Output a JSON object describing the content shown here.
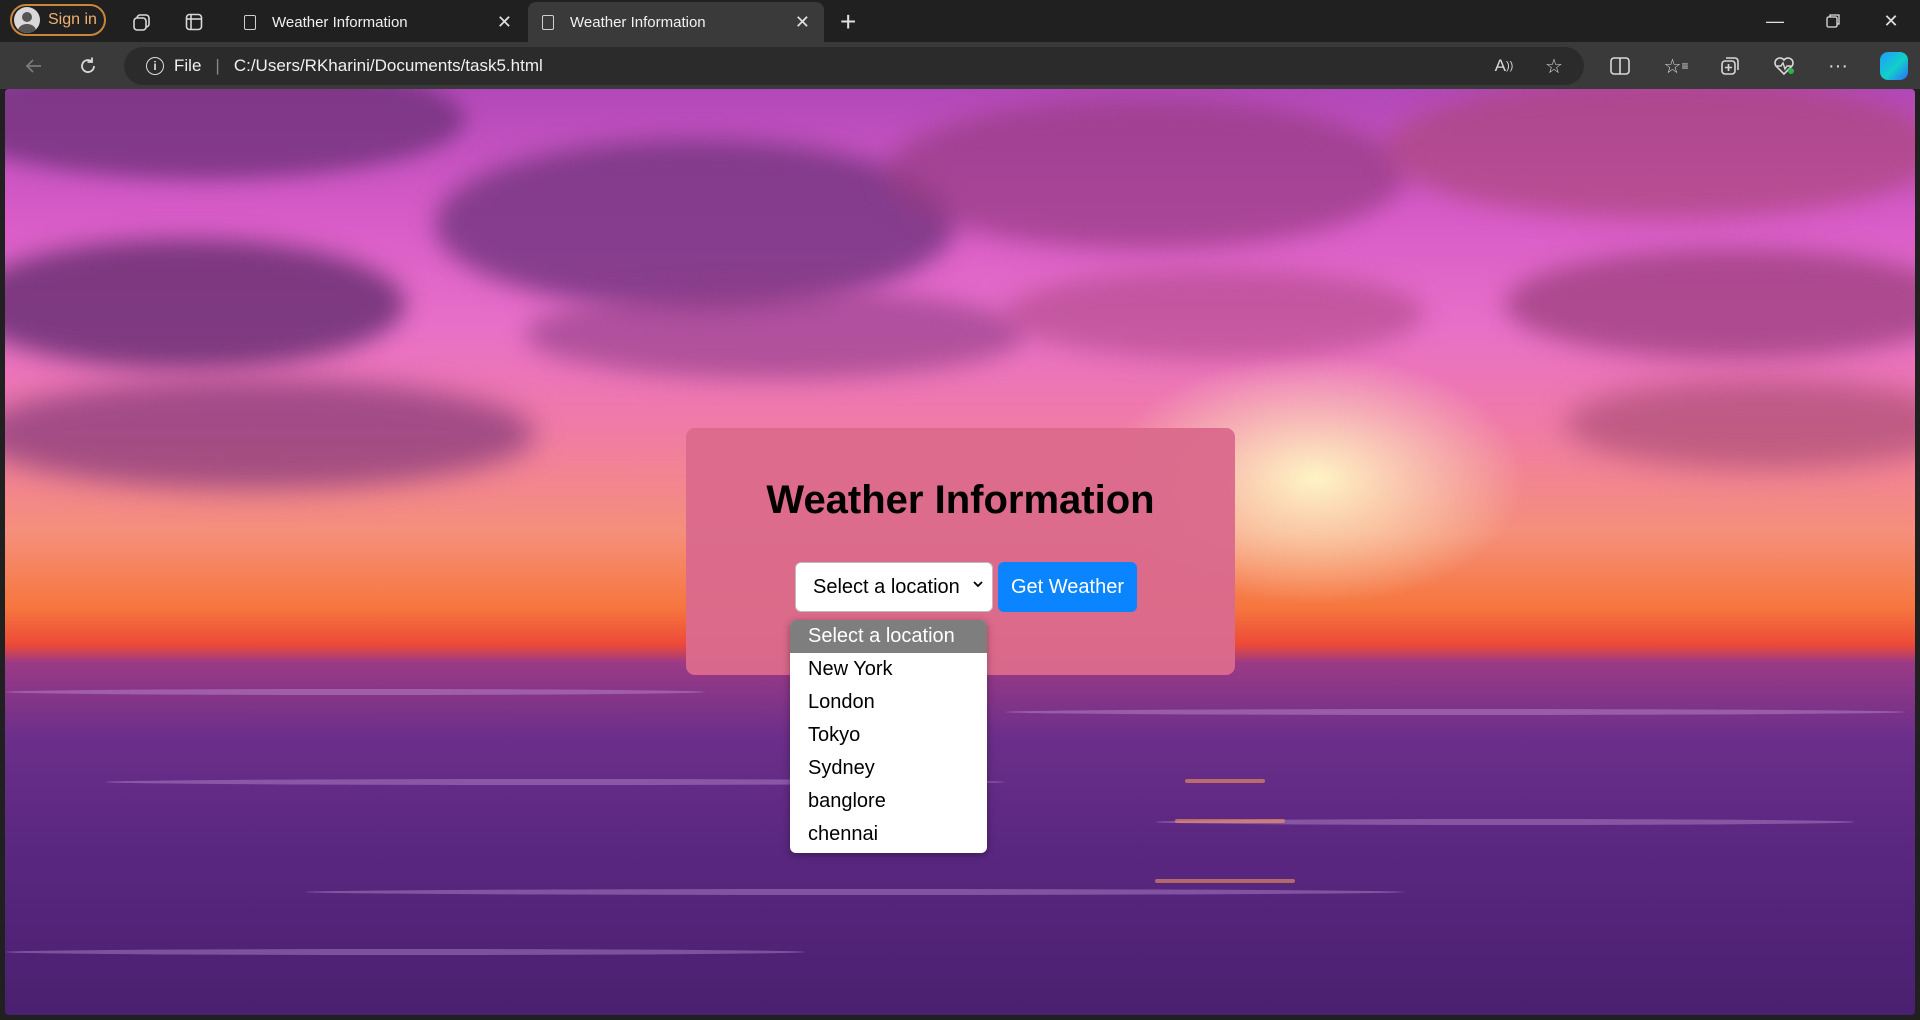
{
  "browser": {
    "signin_label": "Sign in",
    "tabs": [
      {
        "label": "Weather Information",
        "active": false
      },
      {
        "label": "Weather Information",
        "active": true
      }
    ],
    "address": {
      "scheme_label": "File",
      "url": "C:/Users/RKharini/Documents/task5.html"
    },
    "icons": [
      "workspaces-icon",
      "tab-actions-icon",
      "back-icon",
      "refresh-icon",
      "read-aloud-icon",
      "favorite-star-icon",
      "split-screen-icon",
      "favorites-icon",
      "collections-icon",
      "browser-essentials-icon",
      "more-icon",
      "copilot-icon"
    ]
  },
  "page": {
    "title": "Weather Information",
    "location_select": {
      "selected": "Select a location",
      "options": [
        "Select a location",
        "New York",
        "London",
        "Tokyo",
        "Sydney",
        "banglore",
        "chennai"
      ]
    },
    "get_weather_label": "Get Weather",
    "colors": {
      "card_bg": "#db6a8c",
      "button_bg": "#0b84ff",
      "highlight_option": "#7e7e7e"
    }
  }
}
